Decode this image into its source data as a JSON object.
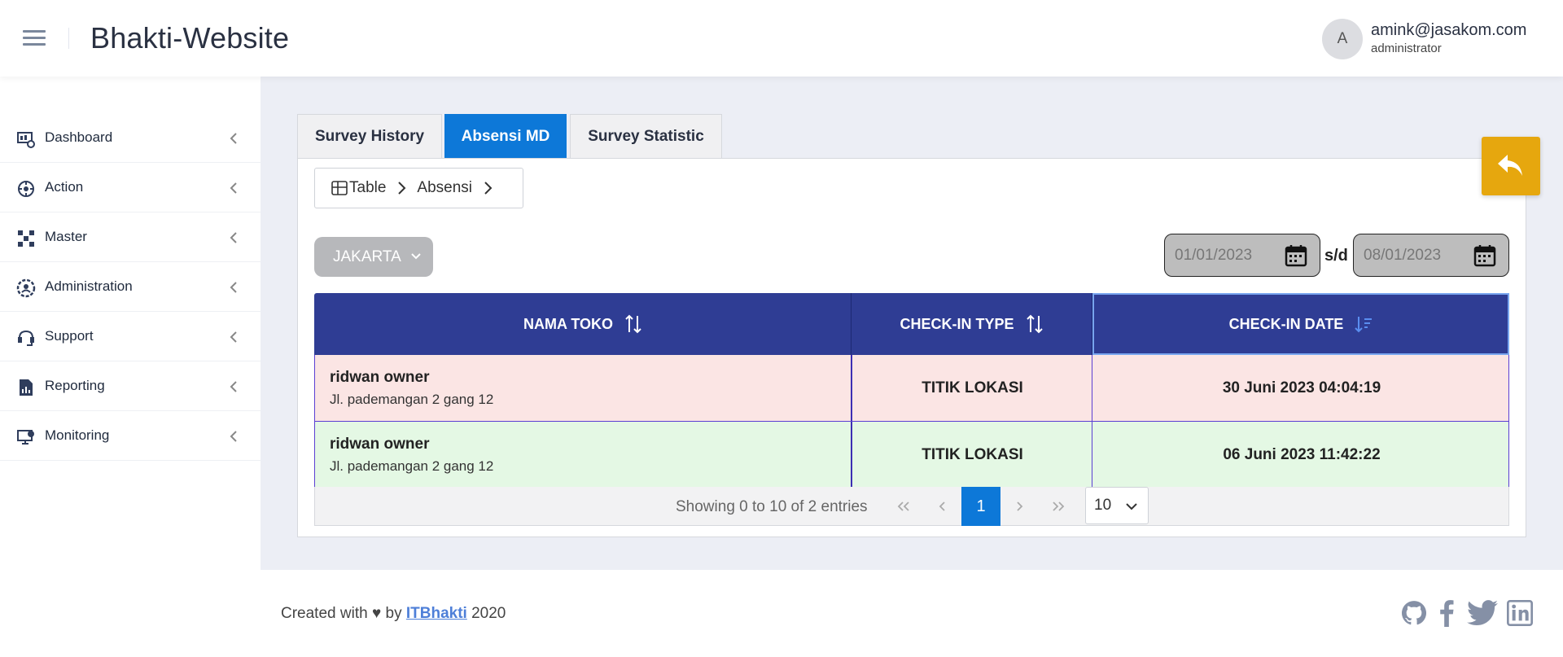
{
  "header": {
    "title": "Bhakti-Website",
    "avatar_letter": "A",
    "user_email": "amink@jasakom.com",
    "user_role": "administrator"
  },
  "sidebar": {
    "items": [
      {
        "label": "Dashboard",
        "icon": "dashboard-icon"
      },
      {
        "label": "Action",
        "icon": "action-icon"
      },
      {
        "label": "Master",
        "icon": "master-icon"
      },
      {
        "label": "Administration",
        "icon": "administration-icon"
      },
      {
        "label": "Support",
        "icon": "support-icon"
      },
      {
        "label": "Reporting",
        "icon": "reporting-icon"
      },
      {
        "label": "Monitoring",
        "icon": "monitoring-icon"
      }
    ]
  },
  "tabs": [
    {
      "label": "Survey History",
      "active": false
    },
    {
      "label": "Absensi MD",
      "active": true
    },
    {
      "label": "Survey Statistic",
      "active": false
    }
  ],
  "breadcrumb": {
    "items": [
      "Table",
      "Absensi"
    ]
  },
  "filters": {
    "region": "JAKARTA",
    "date_from": "01/01/2023",
    "date_to": "08/01/2023",
    "range_sep": "s/d"
  },
  "table": {
    "columns": [
      "NAMA TOKO",
      "CHECK-IN TYPE",
      "CHECK-IN DATE"
    ],
    "sorted_column": "CHECK-IN DATE",
    "rows": [
      {
        "name": "ridwan owner",
        "address": "Jl. pademangan 2 gang 12",
        "type": "TITIK LOKASI",
        "date": "30 Juni 2023 04:04:19",
        "bg": "#fbe5e4"
      },
      {
        "name": "ridwan owner",
        "address": "Jl. pademangan 2 gang 12",
        "type": "TITIK LOKASI",
        "date": "06 Juni 2023 11:42:22",
        "bg": "#e4f8e4"
      }
    ]
  },
  "pagination": {
    "info": "Showing 0 to 10 of 2 entries",
    "current_page": "1",
    "page_size": "10"
  },
  "footer": {
    "prefix": "Created with ♥ by",
    "link": "ITBhakti",
    "year": "2020"
  },
  "colors": {
    "accent": "#0d78d8",
    "table_header": "#2f3d94",
    "back_button": "#e6a70e"
  }
}
